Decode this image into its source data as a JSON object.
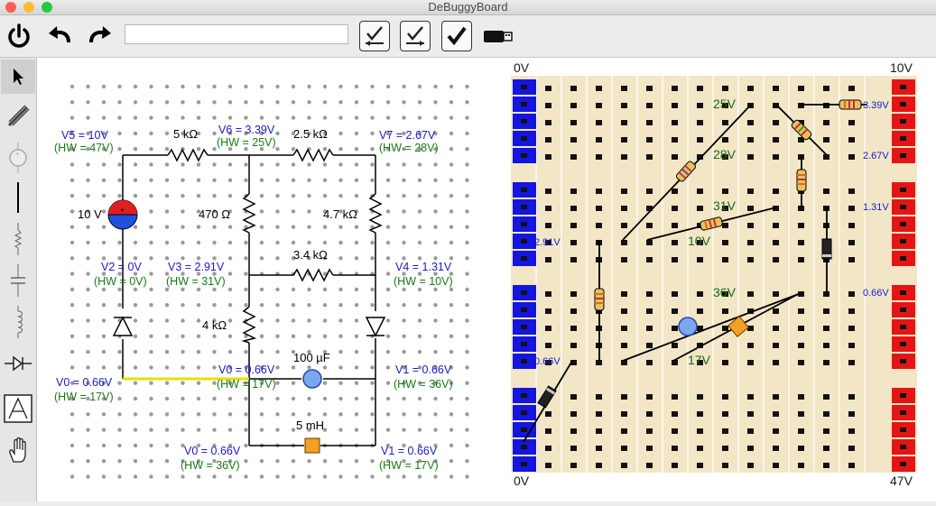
{
  "window": {
    "title": "DeBuggyBoard"
  },
  "toolbar": {
    "search_value": "",
    "power_icon": "power-icon",
    "undo_icon": "undo-icon",
    "redo_icon": "redo-icon"
  },
  "palette": {
    "tools": [
      "select-tool",
      "probe-tool",
      "voltage-source-tool",
      "wire-tool",
      "resistor-tool",
      "capacitor-tool",
      "inductor-tool",
      "diode-tool",
      "text-tool",
      "hand-tool"
    ]
  },
  "schematic": {
    "resistors": [
      "5 kΩ",
      "2.5 kΩ",
      "470 Ω",
      "4.7 kΩ",
      "3.4 kΩ",
      "4 kΩ"
    ],
    "capacitor": "100 µF",
    "inductor": "5 mH",
    "source": "10 V",
    "nodes": [
      {
        "v": "V5 = 10V",
        "hw": "(HW = 47V)"
      },
      {
        "v": "V6 = 3.39V",
        "hw": "(HW = 25V)"
      },
      {
        "v": "V7 = 2.67V",
        "hw": "(HW = 28V)"
      },
      {
        "v": "V2 = 0V",
        "hw": "(HW = 0V)"
      },
      {
        "v": "V3 = 2.91V",
        "hw": "(HW = 31V)"
      },
      {
        "v": "V4 = 1.31V",
        "hw": "(HW = 10V)"
      },
      {
        "v": "V0 = 0.66V",
        "hw": "(HW = 17V)"
      },
      {
        "v": "V0 = 0.66V",
        "hw": "(HW = 17V)"
      },
      {
        "v": "V1 = 0.66V",
        "hw": "(HW = 36V)"
      },
      {
        "v": "V0 = 0.66V",
        "hw": "(HW = 36V)"
      },
      {
        "v": "V1 = 0.66V",
        "hw": "(HW = 17V)"
      }
    ]
  },
  "breadboard": {
    "rail_labels": {
      "top_left": "0V",
      "top_right": "10V",
      "bottom_left": "0V",
      "bottom_right": "47V"
    },
    "hw_labels": [
      "25V",
      "28V",
      "31V",
      "10V",
      "36V",
      "17V"
    ],
    "voltage_labels": [
      "3.39V",
      "2.67V",
      "1.31V",
      "2.91V",
      "0.66V",
      "0.66V"
    ]
  }
}
